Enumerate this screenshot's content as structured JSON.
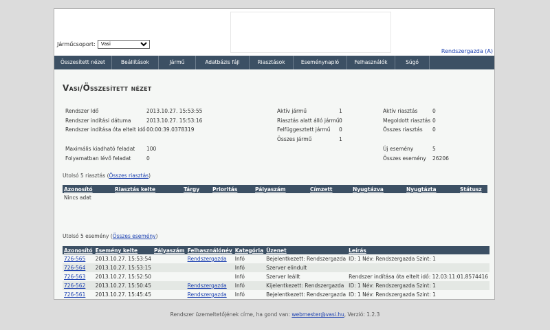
{
  "header": {
    "group_label": "Járműcsoport:",
    "group_value": "Vasi",
    "user": "Rendszergazda (A)"
  },
  "nav": [
    {
      "label": "Összesített nézet"
    },
    {
      "label": "Beállítások"
    },
    {
      "label": "Jármű"
    },
    {
      "label": "Adatbázis fájl"
    },
    {
      "label": "Riasztások"
    },
    {
      "label": "Eseménynapló"
    },
    {
      "label": "Felhasználók"
    },
    {
      "label": "Súgó"
    }
  ],
  "page_title": "Vasi/Összesített nézet",
  "stats": {
    "col1": [
      {
        "k": "Rendszer Idő",
        "v": "2013.10.27. 15:53:55"
      },
      {
        "k": "Rendszer indítási dátuma",
        "v": "2013.10.27. 15:53:16"
      },
      {
        "k": "Rendszer indítása óta eltelt idő",
        "v": "00:00:39.0378319"
      }
    ],
    "col1b": [
      {
        "k": "Maximális kiadható feladat",
        "v": "100"
      },
      {
        "k": "Folyamatban lévő feladat",
        "v": "0"
      }
    ],
    "col2": [
      {
        "k": "Aktív jármű",
        "v": "1"
      },
      {
        "k": "Riasztás alatt álló jármű",
        "v": "0"
      },
      {
        "k": "Felfüggesztett jármű",
        "v": "0"
      },
      {
        "k": "Összes jármű",
        "v": "1"
      }
    ],
    "col3": [
      {
        "k": "Aktív riasztás",
        "v": "0"
      },
      {
        "k": "Megoldott riasztás",
        "v": "0"
      },
      {
        "k": "Összes riasztás",
        "v": "0"
      }
    ],
    "col3b": [
      {
        "k": "Új esemény",
        "v": "5"
      },
      {
        "k": "Összes esemény",
        "v": "26206"
      }
    ]
  },
  "alarms": {
    "label": "Utolsó 5 riasztás (",
    "link": "Összes riasztás",
    "close": ")",
    "headers": [
      "Azonosító",
      "Riasztás kelte",
      "Tárgy",
      "Prioritás",
      "Pályaszám",
      "Címzett",
      "Nyugtázva",
      "Nyugtázta",
      "Státusz"
    ],
    "empty": "Nincs adat"
  },
  "events": {
    "label": "Utolsó 5 esemény (",
    "link": "Összes esemény",
    "close": ")",
    "headers": [
      "Azonosító",
      "Esemény kelte",
      "Pályaszám",
      "Felhasználónév",
      "Kategória",
      "Üzenet",
      "Leírás"
    ],
    "rows": [
      [
        "726-565",
        "2013.10.27. 15:53:54",
        "",
        "Rendszergazda",
        "Infó",
        "Bejelentkezett: Rendszergazda",
        "ID: 1 Név: Rendszergazda Szint: 1"
      ],
      [
        "726-564",
        "2013.10.27. 15:53:15",
        "",
        "",
        "Infó",
        "Szerver elindult",
        ""
      ],
      [
        "726-563",
        "2013.10.27. 15:52:50",
        "",
        "",
        "Infó",
        "Szerver leállt",
        "Rendszer indítása óta eltelt idő: 12.03:11:01.8574416"
      ],
      [
        "726-562",
        "2013.10.27. 15:50:45",
        "",
        "Rendszergazda",
        "Infó",
        "Kijelentkezett: Rendszergazda",
        "ID: 1 Név: Rendszergazda Szint: 1"
      ],
      [
        "726-561",
        "2013.10.27. 15:45:45",
        "",
        "Rendszergazda",
        "Infó",
        "Bejelentkezett: Rendszergazda",
        "ID: 1 Név: Rendszergazda Szint: 1"
      ]
    ]
  },
  "footer": {
    "text": "Rendszer üzemeltetőjének címe, ha gond van:",
    "email": "webmester@vasi.hu",
    "version": ", Verzió: 1.2.3"
  }
}
